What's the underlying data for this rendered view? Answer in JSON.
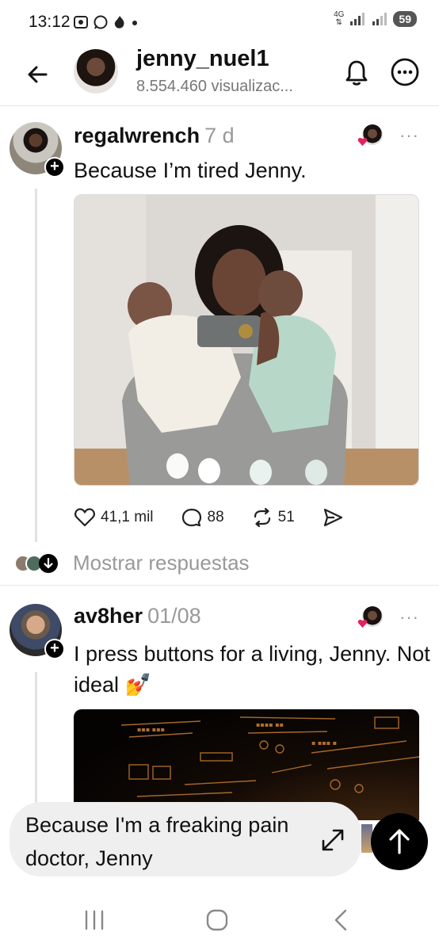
{
  "status_bar": {
    "time": "13:12",
    "network": "4G",
    "battery": "59"
  },
  "header": {
    "username": "jenny_nuel1",
    "views": "8.554.460 visualizac..."
  },
  "posts": [
    {
      "username": "regalwrench",
      "time": "7 d",
      "text": "Because I’m tired Jenny.",
      "likes": "41,1 mil",
      "comments": "88",
      "reposts": "51"
    },
    {
      "username": "av8her",
      "time": "01/08",
      "text": "I press buttons for a living, Jenny. Not ideal 💅"
    }
  ],
  "replies_link": "Mostrar respuestas",
  "composer": {
    "text": "Because I'm a freaking pain doctor,  Jenny"
  },
  "colors": {
    "accent_heart": "#e0245e",
    "muted_text": "#999999"
  }
}
